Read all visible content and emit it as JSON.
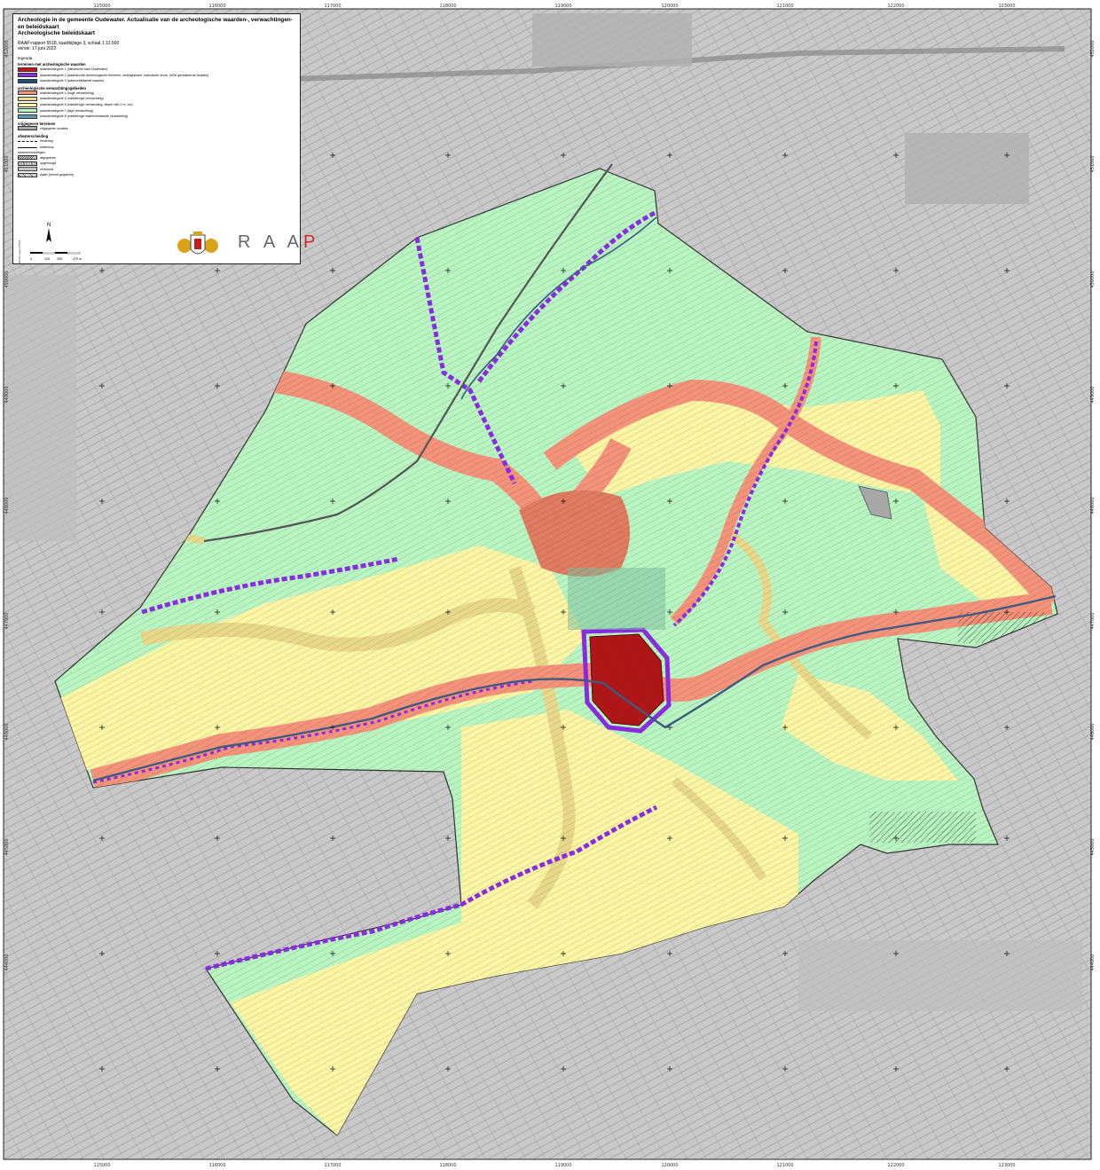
{
  "map": {
    "title_line1": "Archeologie in de gemeente Oudewater. Actualisatie van de archeologische waarden-, verwachtingen- en beleidskaart",
    "title_line2": "Archeologische beleidskaart",
    "report_line": "RAAP-rapport 5518, kaartbijlage 3, schaal 1:12.500",
    "version_line": "versie: 17 juni 2022"
  },
  "legend": {
    "heading": "legenda",
    "groups": [
      {
        "label": "terreinen met archeologische waarden",
        "items": [
          {
            "label": "waardecategorie 1 (historische stad Oudewater)",
            "color": "#c81414"
          },
          {
            "label": "waardecategorie 2 (waardevolle archeologische terreinen, wetingssloten, historische erven, WOII gerelateerde locaties)",
            "color": "#8a2be2"
          },
          {
            "label": "waardecategorie 3 (waterontstaande waarde)",
            "color": "#1f4e79"
          }
        ]
      },
      {
        "label": "archeologische verwachtingsgebieden",
        "items": [
          {
            "label": "waardecategorie 4 (hoge verwachting)",
            "color": "#f4937a"
          },
          {
            "label": "waardecategorie 5 (middelhoge verwachting)",
            "color": "#e8d98a"
          },
          {
            "label": "waardecategorie 6 (middelhoge verwachting, dieper dan 2 m -mv)",
            "color": "#fbf5a4"
          },
          {
            "label": "waardecategorie 7 (lage verwachting)",
            "color": "#b8f5c1"
          },
          {
            "label": "waardecategorie 8 (middelhoge waterontstaande verwachting)",
            "color": "#5e9bb5"
          }
        ]
      },
      {
        "label": "vrijgegeven terreinen",
        "items": [
          {
            "label": "vrijgegeven locaties",
            "color": "#a8a8a8"
          }
        ]
      }
    ],
    "verstoring_label": "afwaterscheiding",
    "lines": [
      {
        "label": "verdeling",
        "style": "dashed"
      },
      {
        "label": "waterloop",
        "style": "solid"
      }
    ],
    "disturbance_label": "bodemverstoringen",
    "hatches": [
      {
        "label": "afgegraven",
        "pattern": "diag"
      },
      {
        "label": "opgehoogd",
        "pattern": "v"
      },
      {
        "label": "verstoord",
        "pattern": "h"
      },
      {
        "label": "water (recent gegraven)",
        "pattern": "x"
      }
    ]
  },
  "scale_bar": {
    "labels": [
      "0",
      "125",
      "250",
      "375 m"
    ]
  },
  "logos": {
    "raap_left": "R A A",
    "raap_right": "P"
  },
  "side_note": "RAAP-rapport 5518",
  "coords": {
    "top": [
      "115000",
      "116000",
      "117000",
      "118000",
      "119000",
      "120000",
      "121000",
      "122000",
      "123000"
    ],
    "bottom": [
      "115000",
      "116000",
      "117000",
      "118000",
      "119000",
      "120000",
      "121000",
      "122000",
      "123000"
    ],
    "left": [
      "452000",
      "451000",
      "450000",
      "449000",
      "448000",
      "447000",
      "446000",
      "445000",
      "444000"
    ],
    "right": [
      "452000",
      "451000",
      "450000",
      "449000",
      "448000",
      "447000",
      "446000",
      "445000",
      "444000"
    ]
  },
  "colors": {
    "background": "#c9c9c9",
    "parcel_lines": "#707070",
    "low": "#b8f5c1",
    "mid_deep": "#fbf5a4",
    "mid": "#e8d98a",
    "high": "#f4937a",
    "town": "#c81414",
    "sites": "#8a2be2",
    "water": "#1f4e79"
  }
}
